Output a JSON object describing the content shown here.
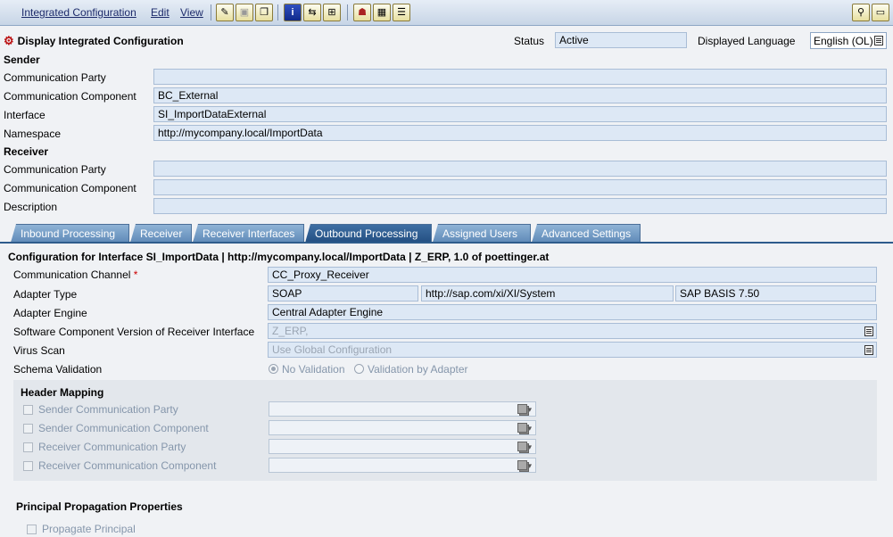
{
  "menu": {
    "integrated_configuration": "Integrated Configuration",
    "edit": "Edit",
    "view": "View"
  },
  "header": {
    "title": "Display Integrated Configuration",
    "status_label": "Status",
    "status_value": "Active",
    "language_label": "Displayed Language",
    "language_value": "English (OL)"
  },
  "sender": {
    "section": "Sender",
    "party_label": "Communication Party",
    "party_value": "",
    "component_label": "Communication Component",
    "component_value": "BC_External",
    "interface_label": "Interface",
    "interface_value": "SI_ImportDataExternal",
    "namespace_label": "Namespace",
    "namespace_value": "http://mycompany.local/ImportData"
  },
  "receiver": {
    "section": "Receiver",
    "party_label": "Communication Party",
    "party_value": "",
    "component_label": "Communication Component",
    "component_value": "",
    "description_label": "Description",
    "description_value": ""
  },
  "tabs": [
    "Inbound Processing",
    "Receiver",
    "Receiver Interfaces",
    "Outbound Processing",
    "Assigned Users",
    "Advanced Settings"
  ],
  "active_tab": "Outbound Processing",
  "outbound": {
    "heading": "Configuration for Interface SI_ImportData | http://mycompany.local/ImportData | Z_ERP, 1.0 of poettinger.at",
    "channel_label": "Communication Channel",
    "required_mark": "*",
    "channel_value": "CC_Proxy_Receiver",
    "adapter_type_label": "Adapter Type",
    "adapter_type": "SOAP",
    "adapter_ns": "http://sap.com/xi/XI/System",
    "adapter_swc": "SAP BASIS 7.50",
    "adapter_engine_label": "Adapter Engine",
    "adapter_engine": "Central Adapter Engine",
    "swcv_label": "Software Component Version of Receiver Interface",
    "swcv_value": "Z_ERP,",
    "virus_label": "Virus Scan",
    "virus_value": "Use Global Configuration",
    "schema_label": "Schema Validation",
    "schema_opt1": "No Validation",
    "schema_opt2": "Validation by Adapter",
    "header_mapping": {
      "title": "Header Mapping",
      "rows": [
        "Sender Communication Party",
        "Sender Communication Component",
        "Receiver Communication Party",
        "Receiver Communication Component"
      ]
    },
    "principal": {
      "title": "Principal Propagation Properties",
      "propagate": "Propagate Principal"
    }
  }
}
